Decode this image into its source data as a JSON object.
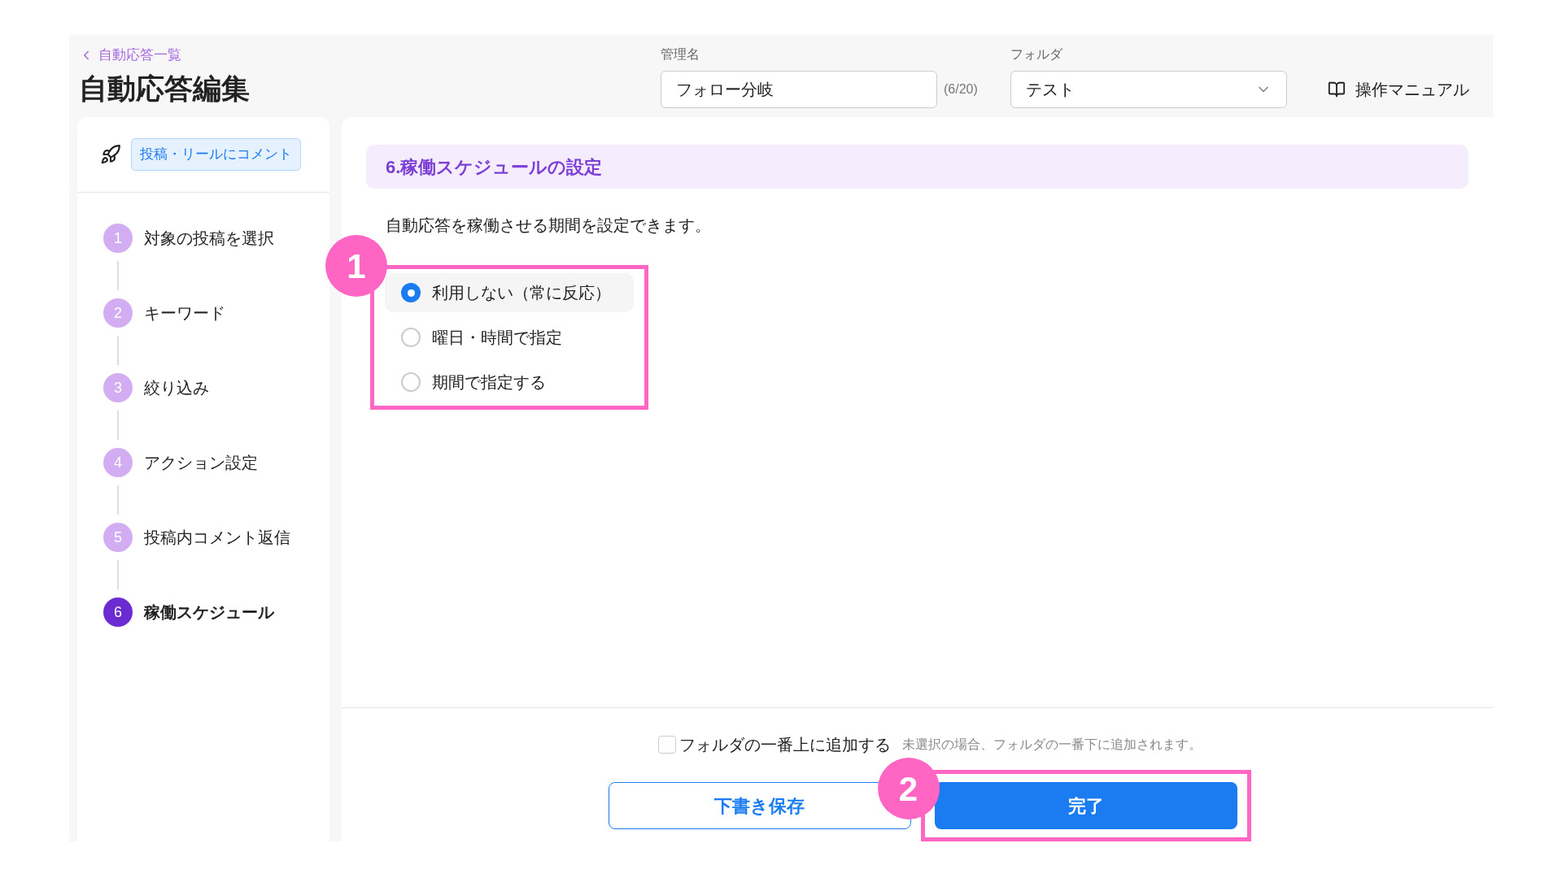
{
  "header": {
    "back_link": "自動応答一覧",
    "title": "自動応答編集",
    "name_field": {
      "label": "管理名",
      "value": "フォロー分岐",
      "counter": "(6/20)"
    },
    "folder_field": {
      "label": "フォルダ",
      "value": "テスト"
    },
    "manual_link": "操作マニュアル"
  },
  "sidebar": {
    "trigger_badge": "投稿・リールにコメント",
    "steps": [
      {
        "number": "1",
        "label": "対象の投稿を選択",
        "selected": false
      },
      {
        "number": "2",
        "label": "キーワード",
        "selected": false
      },
      {
        "number": "3",
        "label": "絞り込み",
        "selected": false
      },
      {
        "number": "4",
        "label": "アクション設定",
        "selected": false
      },
      {
        "number": "5",
        "label": "投稿内コメント返信",
        "selected": false
      },
      {
        "number": "6",
        "label": "稼働スケジュール",
        "selected": true
      }
    ]
  },
  "main": {
    "section_title": "6.稼働スケジュールの設定",
    "description": "自動応答を稼働させる期間を設定できます。",
    "schedule_options": {
      "callout": "1",
      "options": [
        {
          "label": "利用しない（常に反応）",
          "selected": true
        },
        {
          "label": "曜日・時間で指定",
          "selected": false
        },
        {
          "label": "期間で指定する",
          "selected": false
        }
      ]
    }
  },
  "footer": {
    "add_to_top": {
      "label": "フォルダの一番上に追加する",
      "checked": false,
      "hint": "未選択の場合、フォルダの一番下に追加されます。"
    },
    "draft_button": "下書き保存",
    "done_button": {
      "label": "完了",
      "callout": "2"
    }
  }
}
